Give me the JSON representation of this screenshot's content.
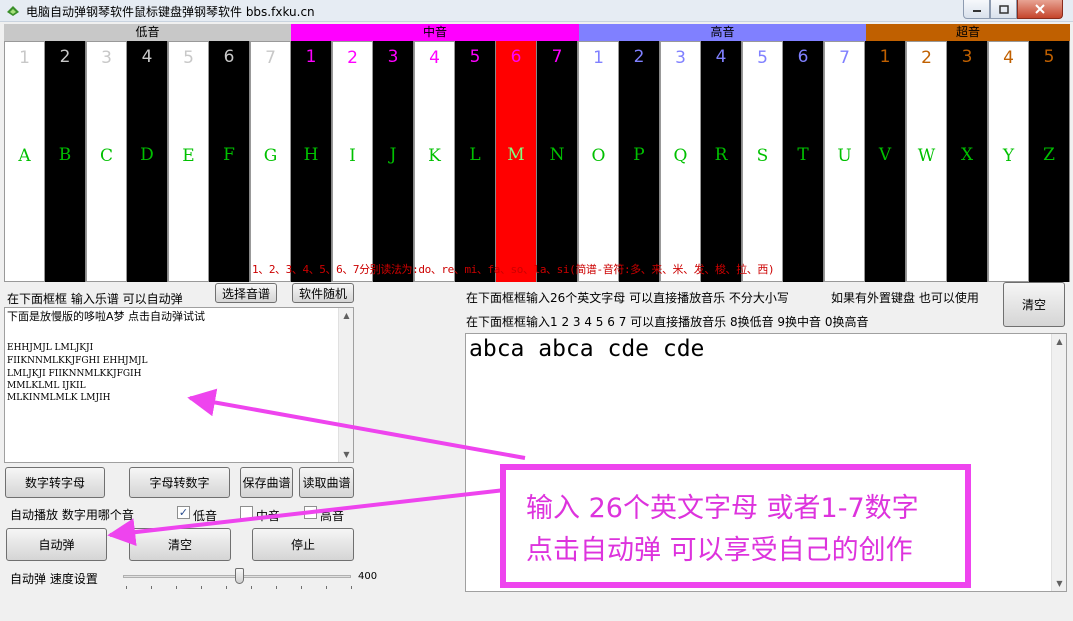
{
  "window": {
    "title": "电脑自动弹钢琴软件鼠标键盘弹钢琴软件    bbs.fxku.cn"
  },
  "piano": {
    "sections": [
      {
        "label": "低音",
        "color": "#c8c8c8"
      },
      {
        "label": "中音",
        "color": "#ff00ff"
      },
      {
        "label": "高音",
        "color": "#8080ff"
      },
      {
        "label": "超音",
        "color": "#c06000"
      }
    ],
    "keys": [
      {
        "num": "1",
        "letter": "A",
        "kind": "white",
        "num_color": "#c8c8c8"
      },
      {
        "num": "2",
        "letter": "B",
        "kind": "black",
        "num_color": "#c8c8c8"
      },
      {
        "num": "3",
        "letter": "C",
        "kind": "white",
        "num_color": "#c8c8c8"
      },
      {
        "num": "4",
        "letter": "D",
        "kind": "black",
        "num_color": "#c8c8c8"
      },
      {
        "num": "5",
        "letter": "E",
        "kind": "white",
        "num_color": "#c8c8c8"
      },
      {
        "num": "6",
        "letter": "F",
        "kind": "black",
        "num_color": "#c8c8c8"
      },
      {
        "num": "7",
        "letter": "G",
        "kind": "white",
        "num_color": "#c8c8c8"
      },
      {
        "num": "1",
        "letter": "H",
        "kind": "black",
        "num_color": "#ff00ff"
      },
      {
        "num": "2",
        "letter": "I",
        "kind": "white",
        "num_color": "#ff00ff"
      },
      {
        "num": "3",
        "letter": "J",
        "kind": "black",
        "num_color": "#ff00ff"
      },
      {
        "num": "4",
        "letter": "K",
        "kind": "white",
        "num_color": "#ff00ff"
      },
      {
        "num": "5",
        "letter": "L",
        "kind": "black",
        "num_color": "#ff00ff"
      },
      {
        "num": "6",
        "letter": "M",
        "kind": "red",
        "num_color": "#ff00ff"
      },
      {
        "num": "7",
        "letter": "N",
        "kind": "black",
        "num_color": "#ff00ff"
      },
      {
        "num": "1",
        "letter": "O",
        "kind": "white",
        "num_color": "#8080ff"
      },
      {
        "num": "2",
        "letter": "P",
        "kind": "black",
        "num_color": "#8080ff"
      },
      {
        "num": "3",
        "letter": "Q",
        "kind": "white",
        "num_color": "#8080ff"
      },
      {
        "num": "4",
        "letter": "R",
        "kind": "black",
        "num_color": "#8080ff"
      },
      {
        "num": "5",
        "letter": "S",
        "kind": "white",
        "num_color": "#8080ff"
      },
      {
        "num": "6",
        "letter": "T",
        "kind": "black",
        "num_color": "#8080ff"
      },
      {
        "num": "7",
        "letter": "U",
        "kind": "white",
        "num_color": "#8080ff"
      },
      {
        "num": "1",
        "letter": "V",
        "kind": "black",
        "num_color": "#c06000"
      },
      {
        "num": "2",
        "letter": "W",
        "kind": "white",
        "num_color": "#c06000"
      },
      {
        "num": "3",
        "letter": "X",
        "kind": "black",
        "num_color": "#c06000"
      },
      {
        "num": "4",
        "letter": "Y",
        "kind": "white",
        "num_color": "#c06000"
      },
      {
        "num": "5",
        "letter": "Z",
        "kind": "black",
        "num_color": "#c06000"
      }
    ],
    "solfege_note": "1、2、3、4、5、6、7分别读法为:do、re、mi、fa、so、la、si(简谱-音符:多、来、米、发、梭、拉、西)"
  },
  "left_panel": {
    "input_hint": "在下面框框  输入乐谱 可以自动弹",
    "select_score_button": "选择音谱",
    "random_button": "软件随机",
    "editor_lines": [
      "下面是放慢版的哆啦A梦  点击自动弹试试",
      "",
      "EHHJMJL LMLJKJI",
      "FIIKNNMLKKJFGHI EHHJMJL",
      "LMLJKJI FIIKNNMLKKJFGIH",
      "MMLKLML IJKIL",
      "MLKINMLMLK LMJIH"
    ],
    "num_to_letter_button": "数字转字母",
    "letter_to_num_button": "字母转数字",
    "save_button": "保存曲谱",
    "load_button": "读取曲谱",
    "autoplay_label": "自动播放 数字用哪个音",
    "checkboxes": [
      {
        "label": "低音",
        "checked": true
      },
      {
        "label": "中音",
        "checked": false
      },
      {
        "label": "高音",
        "checked": false
      }
    ],
    "autoplay_button": "自动弹",
    "clear_button": "清空",
    "stop_button": "停止",
    "speed_label": "自动弹  速度设置",
    "speed_value": "400",
    "speed_fraction": 0.52
  },
  "right_panel": {
    "hint_line1": "在下面框框输入26个英文字母  可以直接播放音乐   不分大小写",
    "hint_external": "如果有外置键盘 也可以使用",
    "hint_line2": "在下面框框输入1 2 3 4 5 6 7 可以直接播放音乐   8换低音 9换中音 0换高音",
    "clear_button": "清空",
    "editor_text": "abca abca cde cde"
  },
  "annotation": {
    "line1": "输入 26个英文字母 或者1-7数字",
    "line2": "点击自动弹   可以享受自己的创作",
    "color": "#ee44ee"
  }
}
